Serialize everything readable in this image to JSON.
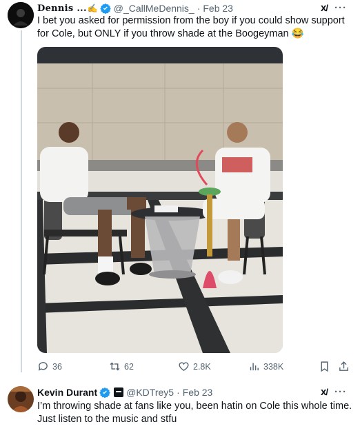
{
  "tweet1": {
    "display_name": "Dennis ...",
    "name_emoji": "✍️",
    "handle": "@_CallMeDennis_",
    "date": "Feb 23",
    "text": "I bet you asked for permission from the boy if you could show support for Cole, but ONLY if you throw shade at the Boogeyman 😂",
    "stats": {
      "replies": "36",
      "reposts": "62",
      "likes": "2.8K",
      "views": "338K"
    }
  },
  "tweet2": {
    "display_name": "Kevin Durant",
    "handle": "@KDTrey5",
    "date": "Feb 23",
    "text": "I’m throwing shade at fans like you, been hatin on Cole this whole time. Just listen to the music and stfu"
  },
  "colors": {
    "verified": "#1d9bf0",
    "muted": "#536471",
    "text": "#0f1419"
  }
}
